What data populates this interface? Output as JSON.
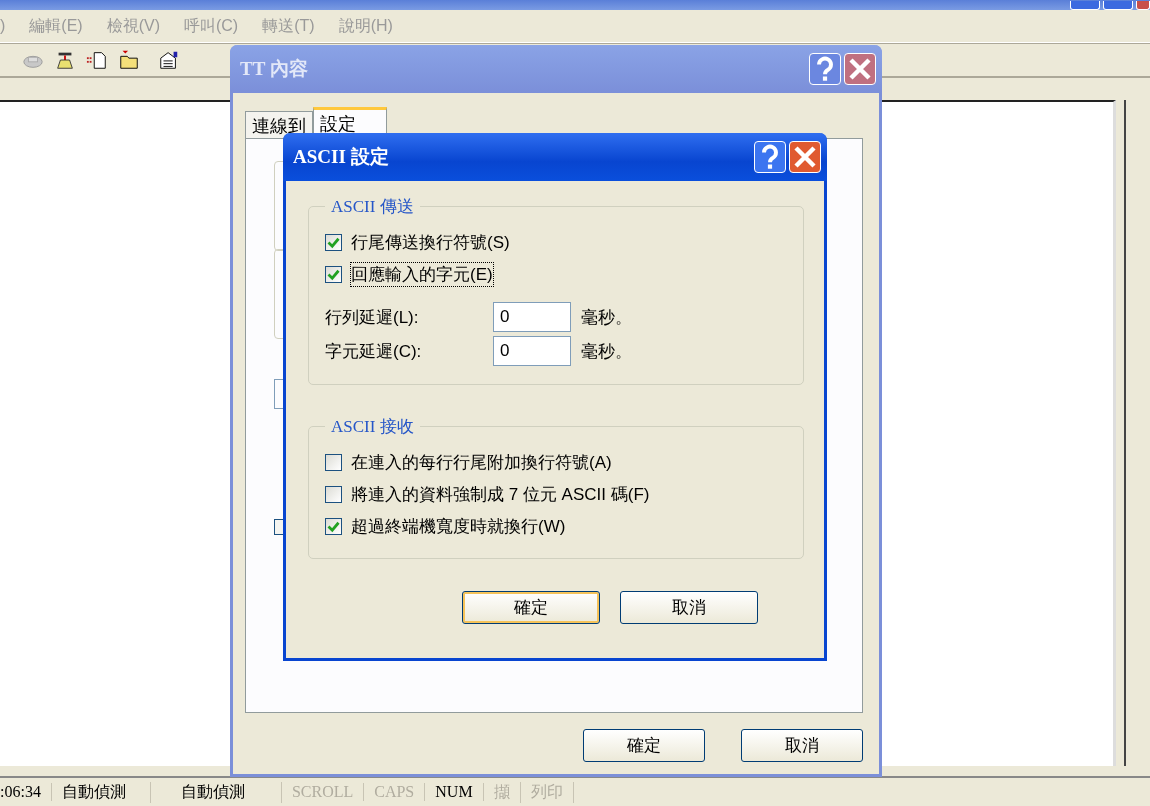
{
  "app": {
    "menu": [
      ")",
      "編輯(E)",
      "檢視(V)",
      "呼叫(C)",
      "轉送(T)",
      "說明(H)"
    ]
  },
  "properties_dialog": {
    "title": "TT 內容",
    "tabs": [
      {
        "label": "連線到",
        "selected": false
      },
      {
        "label": "設定",
        "selected": true
      }
    ],
    "buttons": [
      {
        "label": "確定",
        "default": false
      },
      {
        "label": "取消",
        "default": false
      }
    ],
    "option_checkbox": {
      "checked": false
    }
  },
  "ascii_dialog": {
    "title": "ASCII 設定",
    "send_group": {
      "title": "ASCII 傳送",
      "options": [
        {
          "label": "行尾傳送換行符號(S)",
          "checked": true,
          "focused": false
        },
        {
          "label": "回應輸入的字元(E)",
          "checked": true,
          "focused": true
        }
      ],
      "delays": [
        {
          "label": "行列延遲(L):",
          "value": "0",
          "unit": "毫秒。"
        },
        {
          "label": "字元延遲(C):",
          "value": "0",
          "unit": "毫秒。"
        }
      ]
    },
    "receive_group": {
      "title": "ASCII 接收",
      "options": [
        {
          "label": "在連入的每行行尾附加換行符號(A)",
          "checked": false,
          "focused": false
        },
        {
          "label": "將連入的資料強制成 7 位元 ASCII 碼(F)",
          "checked": false,
          "focused": false
        },
        {
          "label": "超過終端機寬度時就換行(W)",
          "checked": true,
          "focused": false
        }
      ]
    },
    "buttons": [
      {
        "label": "確定",
        "default": true
      },
      {
        "label": "取消",
        "default": false
      }
    ]
  },
  "status_bar": [
    {
      "text": ":06:34",
      "on": true
    },
    {
      "text": "自動偵測",
      "on": true
    },
    {
      "text": "自動偵測",
      "on": true
    },
    {
      "text": "SCROLL",
      "on": false
    },
    {
      "text": "CAPS",
      "on": false
    },
    {
      "text": "NUM",
      "on": true
    },
    {
      "text": "擷",
      "on": false
    },
    {
      "text": "列印",
      "on": false
    }
  ]
}
